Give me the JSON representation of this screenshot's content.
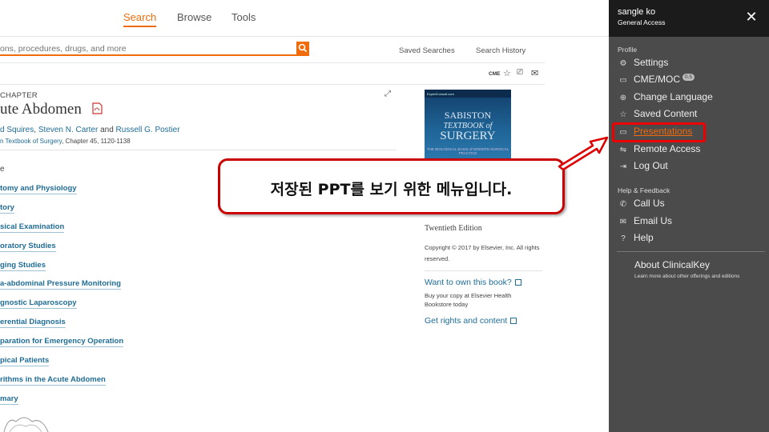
{
  "nav": {
    "search": "Search",
    "browse": "Browse",
    "tools": "Tools"
  },
  "search": {
    "placeholder": "ons, procedures, drugs, and more"
  },
  "toplinks": {
    "saved_searches": "Saved Searches",
    "search_history": "Search History",
    "cme": "CME"
  },
  "chapter": {
    "label": "CHAPTER",
    "title": "ute Abdomen",
    "authors_pre": "d Squires",
    "author2": "Steven N. Carter",
    "and": "and",
    "author3": "Russell G. Postier",
    "source_link": "n Textbook of Surgery",
    "source_rest": ", Chapter 45, 1120-1138",
    "outline_head": "e"
  },
  "toc": [
    "tomy and Physiology",
    "tory",
    "sical Examination",
    "oratory Studies",
    "ging Studies",
    "a-abdominal Pressure Monitoring",
    "gnostic Laparoscopy",
    "erential Diagnosis",
    "paration for Emergency Operation",
    "pical Patients",
    "rithms in the Acute Abdomen",
    "mary"
  ],
  "book": {
    "cover_top": "ExpertConsult.com",
    "cover_title_1": "SABISTON",
    "cover_title_2": "TEXTBOOK of",
    "cover_title_3": "SURGERY",
    "cover_sub": "THE BIOLOGICAL BASIS of MODERN SURGICAL PRACTICE",
    "edition": "Twentieth Edition",
    "copyright": "Copyright © 2017 by Elsevier, Inc. All rights reserved.",
    "own": "Want to own this book?",
    "buy": "Buy your copy at Elsevier Health Bookstore today",
    "rights": "Get rights and content"
  },
  "callout": {
    "text": "저장된 PPT를 보기 위한 메뉴입니다."
  },
  "menu": {
    "user_name": "sangle  ko",
    "access": "General Access",
    "close": "✕",
    "profile_head": "Profile",
    "items": [
      {
        "label": "Settings",
        "icon": "settings-icon"
      },
      {
        "label": "CME/MOC",
        "icon": "cme-icon",
        "badge": "0.5"
      },
      {
        "label": "Change Language",
        "icon": "globe-icon"
      },
      {
        "label": "Saved Content",
        "icon": "star-icon"
      },
      {
        "label": "Presentations",
        "icon": "presentation-icon"
      },
      {
        "label": "Remote Access",
        "icon": "remote-icon"
      },
      {
        "label": "Log Out",
        "icon": "logout-icon"
      }
    ],
    "help_head": "Help & Feedback",
    "help_items": [
      {
        "label": "Call Us",
        "icon": "phone-icon"
      },
      {
        "label": "Email Us",
        "icon": "mail-icon"
      },
      {
        "label": "Help",
        "icon": "help-icon"
      }
    ],
    "about": "About ClinicalKey",
    "about_sub": "Learn more about other offerings and editions"
  },
  "colors": {
    "accent": "#f26b0a",
    "link": "#1f6c96",
    "panel": "#4b4b4b",
    "callout_border": "#cc0000"
  }
}
